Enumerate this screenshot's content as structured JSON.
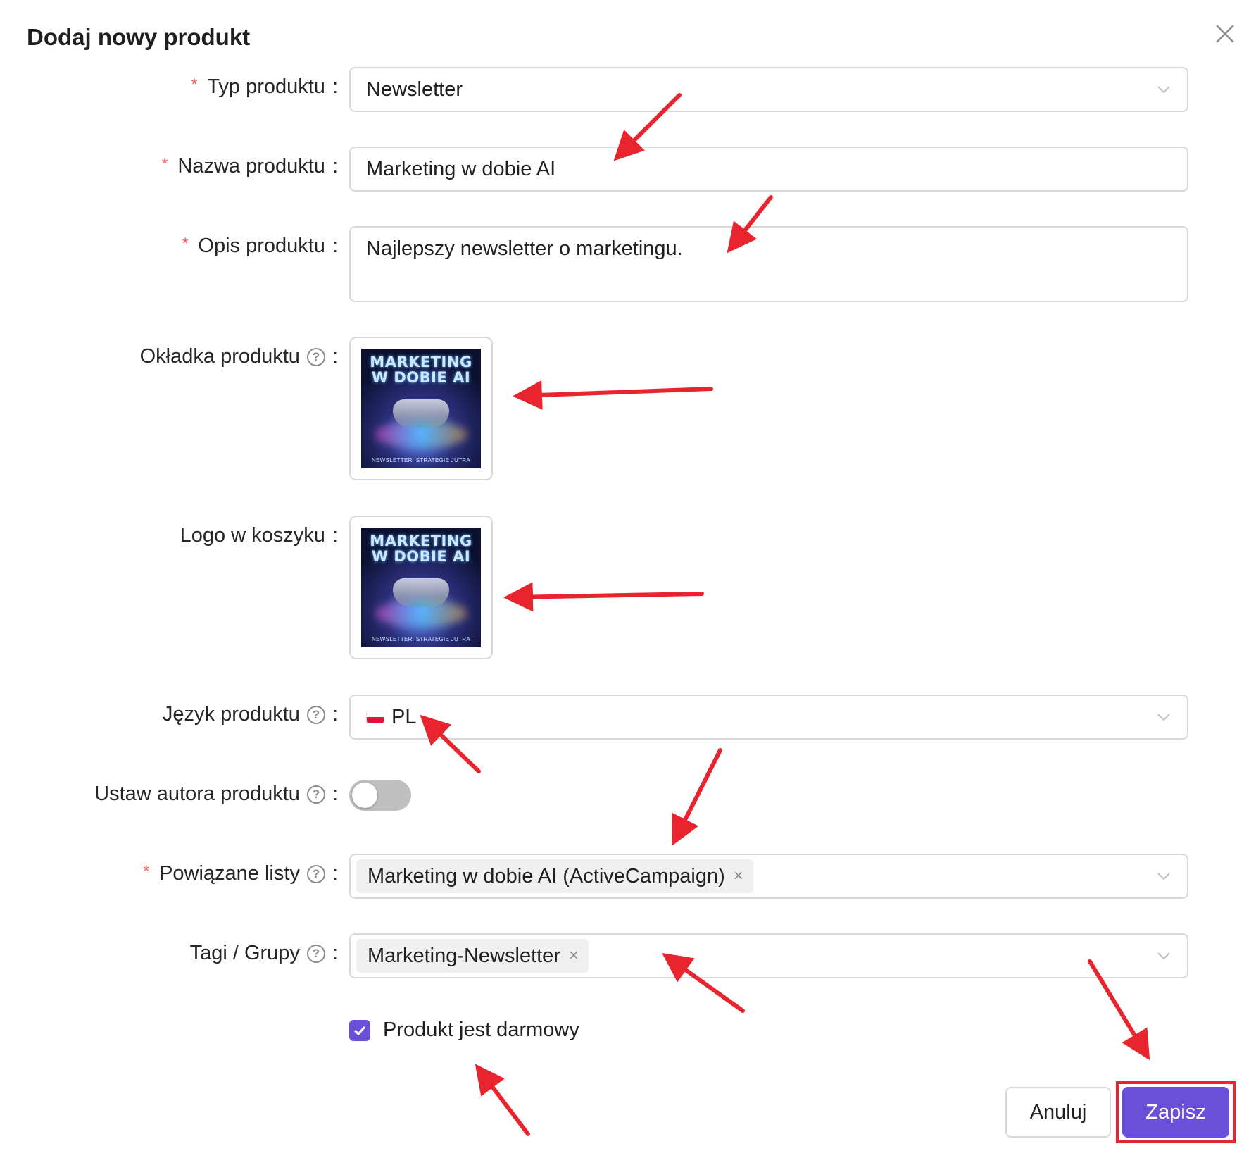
{
  "dialog": {
    "title": "Dodaj nowy produkt"
  },
  "fields": {
    "type": {
      "label": "Typ produktu",
      "value": "Newsletter"
    },
    "name": {
      "label": "Nazwa produktu",
      "value": "Marketing w dobie AI"
    },
    "description": {
      "label": "Opis produktu",
      "value": "Najlepszy newsletter o marketingu."
    },
    "cover": {
      "label": "Okładka produktu",
      "image_title": "MARKETING\nW DOBIE AI",
      "image_subtitle": "NEWSLETTER: STRATEGIE JUTRA"
    },
    "cart_logo": {
      "label": "Logo w koszyku",
      "image_title": "MARKETING\nW DOBIE AI",
      "image_subtitle": "NEWSLETTER: STRATEGIE JUTRA"
    },
    "language": {
      "label": "Język produktu",
      "value": "PL"
    },
    "author": {
      "label": "Ustaw autora produktu",
      "enabled": false
    },
    "lists": {
      "label": "Powiązane listy",
      "tags": [
        "Marketing w dobie AI (ActiveCampaign)"
      ]
    },
    "groups": {
      "label": "Tagi / Grupy",
      "tags": [
        "Marketing-Newsletter"
      ]
    },
    "free": {
      "label": "Produkt jest darmowy",
      "checked": true
    }
  },
  "buttons": {
    "cancel": "Anuluj",
    "save": "Zapisz"
  },
  "colors": {
    "primary": "#6a4fd8",
    "required": "#ff4d4f",
    "annotation": "#e8242f"
  }
}
